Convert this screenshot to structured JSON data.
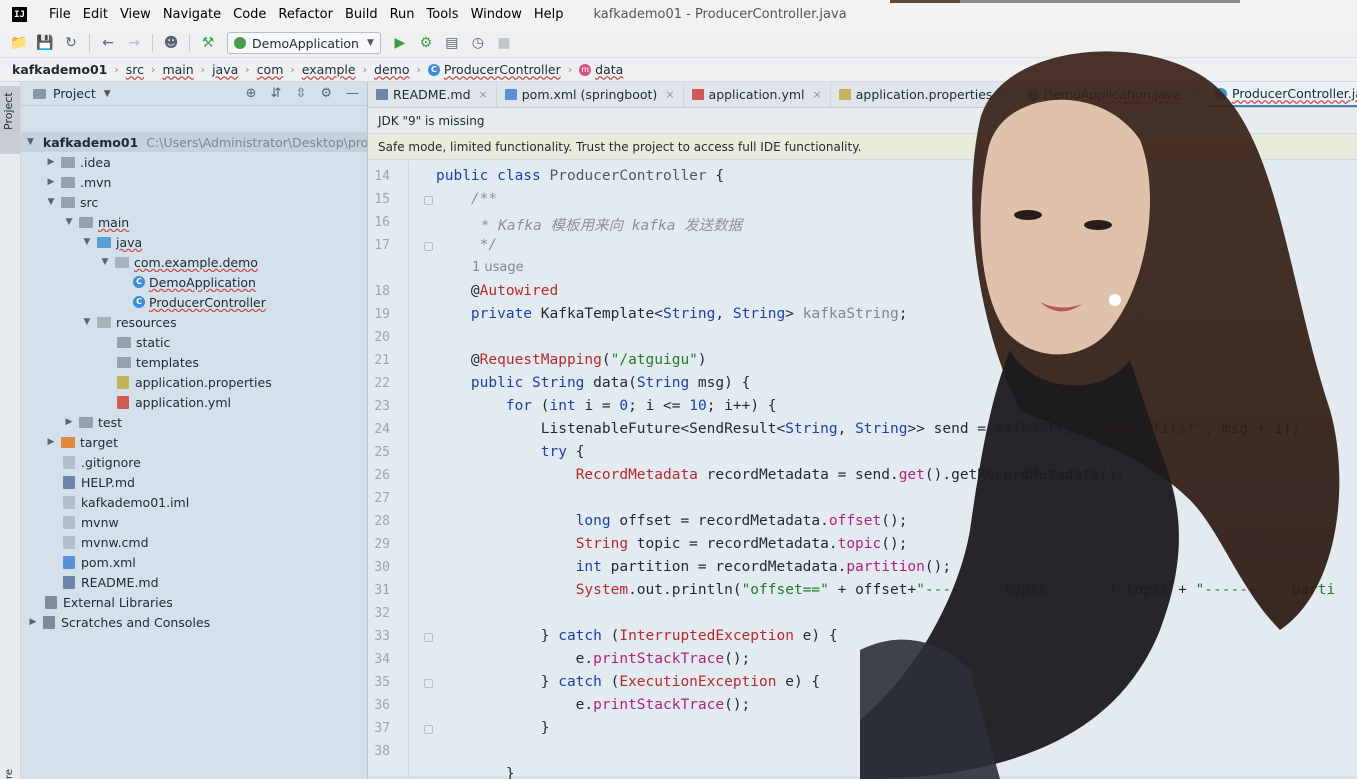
{
  "menu": {
    "items": [
      "File",
      "Edit",
      "View",
      "Navigate",
      "Code",
      "Refactor",
      "Build",
      "Run",
      "Tools",
      "Window",
      "Help"
    ],
    "window_title": "kafkademo01 - ProducerController.java",
    "logo": "IJ"
  },
  "toolbar": {
    "run_config": "DemoApplication"
  },
  "breadcrumb": [
    "kafkademo01",
    "src",
    "main",
    "java",
    "com",
    "example",
    "demo",
    "ProducerController",
    "data"
  ],
  "tool_strip": {
    "project_tab": "Project",
    "bottom_label": "re"
  },
  "project_panel": {
    "title": "Project",
    "root": {
      "name": "kafkademo01",
      "path": "C:\\Users\\Administrator\\Desktop\\project\\k"
    },
    "items": [
      ".idea",
      ".mvn",
      "src",
      "main",
      "java",
      "com.example.demo",
      "DemoApplication",
      "ProducerController",
      "resources",
      "static",
      "templates",
      "application.properties",
      "application.yml",
      "test",
      "target",
      ".gitignore",
      "HELP.md",
      "kafkademo01.iml",
      "mvnw",
      "mvnw.cmd",
      "pom.xml",
      "README.md",
      "External Libraries",
      "Scratches and Consoles"
    ]
  },
  "tabs": [
    {
      "label": "README.md"
    },
    {
      "label": "pom.xml (springboot)"
    },
    {
      "label": "application.yml"
    },
    {
      "label": "application.properties"
    },
    {
      "label": "DemoApplication.java"
    },
    {
      "label": "ProducerController.java"
    }
  ],
  "banners": {
    "jdk": "JDK \"9\" is missing",
    "safe_mode": "Safe mode, limited functionality. Trust the project to access full IDE functionality."
  },
  "editor": {
    "line_numbers": [
      "14",
      "15",
      "16",
      "17",
      "",
      "18",
      "19",
      "20",
      "21",
      "22",
      "23",
      "24",
      "25",
      "26",
      "27",
      "28",
      "29",
      "30",
      "31",
      "32",
      "33",
      "34",
      "35",
      "36",
      "37",
      "38"
    ],
    "usage_hint": "1 usage",
    "comment_text": " * Kafka 模板用来向 kafka 发送数据"
  },
  "colors": {
    "accent": "#4a82b8",
    "keyword": "#1c3fa6",
    "string": "#1d7d29",
    "annotation": "#b0227a"
  }
}
